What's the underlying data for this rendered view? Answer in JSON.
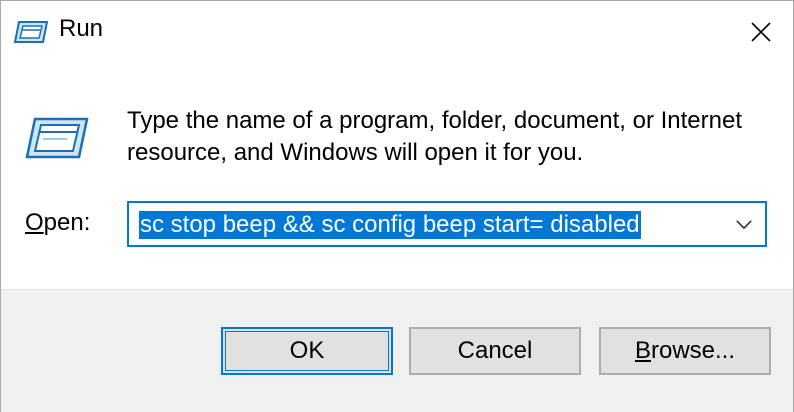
{
  "window": {
    "title": "Run",
    "icon": "run-app-icon"
  },
  "dialog": {
    "description": "Type the name of a program, folder, document, or Internet resource, and Windows will open it for you.",
    "open_label_underlined": "O",
    "open_label_rest": "pen:",
    "command_value": "sc stop beep && sc config beep start= disabled"
  },
  "buttons": {
    "ok": "OK",
    "cancel": "Cancel",
    "browse_underlined": "B",
    "browse_rest": "rowse..."
  },
  "colors": {
    "accent": "#0078d7",
    "footer": "#f0f0f0",
    "button": "#e1e1e1"
  }
}
